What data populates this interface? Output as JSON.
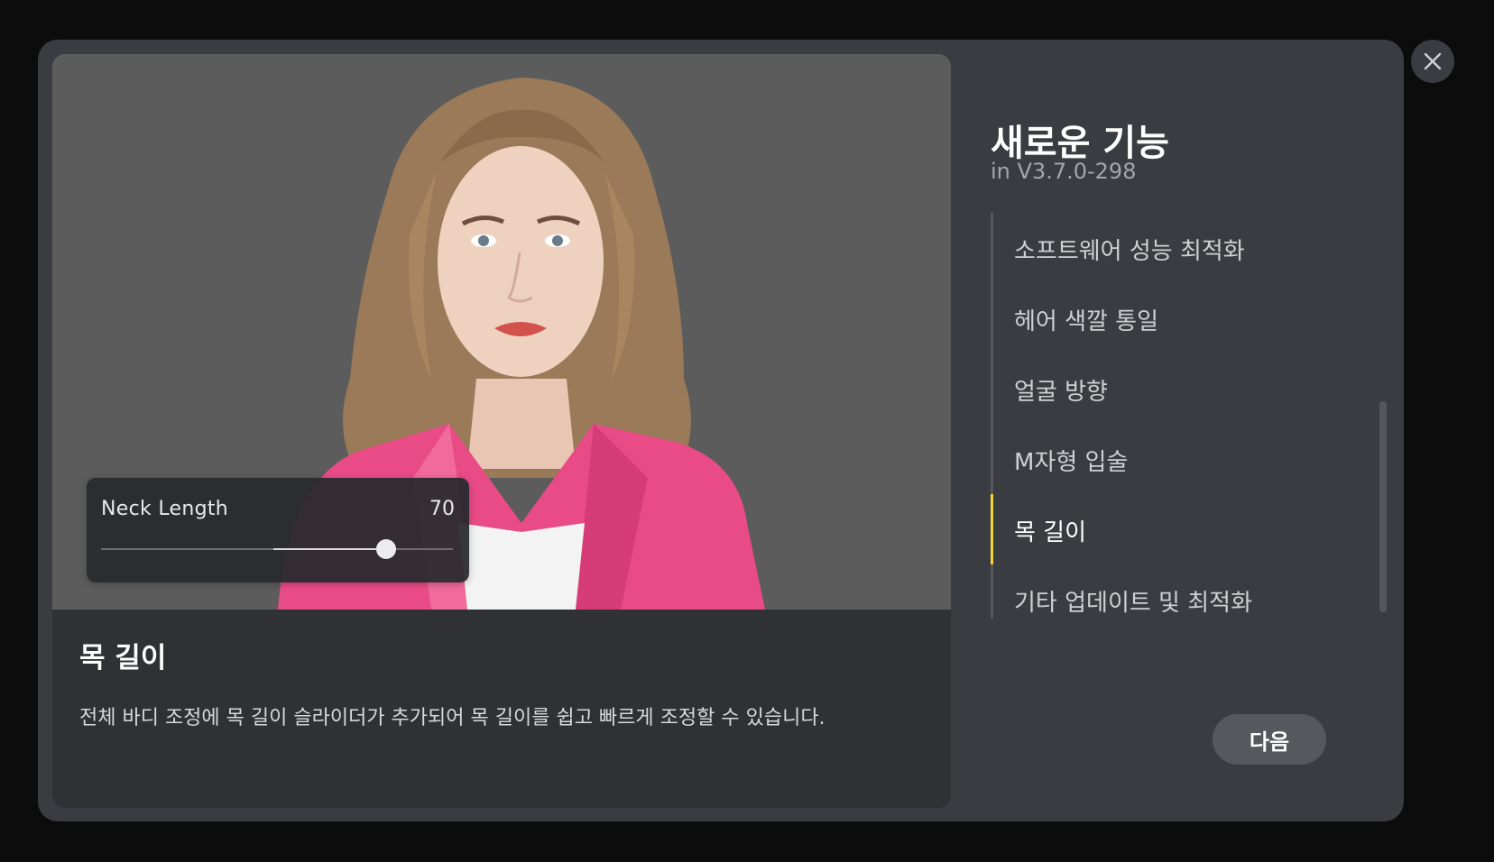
{
  "preview": {
    "slider": {
      "label": "Neck Length",
      "value": "70",
      "fraction": 0.81,
      "segment_start_fraction": 0.49
    }
  },
  "feature": {
    "title": "목 길이",
    "description": "전체 바디 조정에 목 길이 슬라이더가 추가되어 목 길이를 쉽고 빠르게 조정할 수 있습니다."
  },
  "sidebar": {
    "heading": "새로운 기능",
    "version": "in V3.7.0-298",
    "items": [
      {
        "label": "소프트웨어 성능 최적화",
        "active": false
      },
      {
        "label": "헤어 색깔 통일",
        "active": false
      },
      {
        "label": "얼굴 방향",
        "active": false
      },
      {
        "label": "M자형 입술",
        "active": false
      },
      {
        "label": "목 길이",
        "active": true
      },
      {
        "label": "기타 업데이트 및 최적화",
        "active": false
      }
    ]
  },
  "buttons": {
    "next_label": "다음",
    "close_icon": "close-icon"
  },
  "colors": {
    "accent": "#f4d23b",
    "modal_bg": "#3a3c41",
    "card_bg": "#2f3135",
    "preview_bg": "#5c5c5c"
  }
}
